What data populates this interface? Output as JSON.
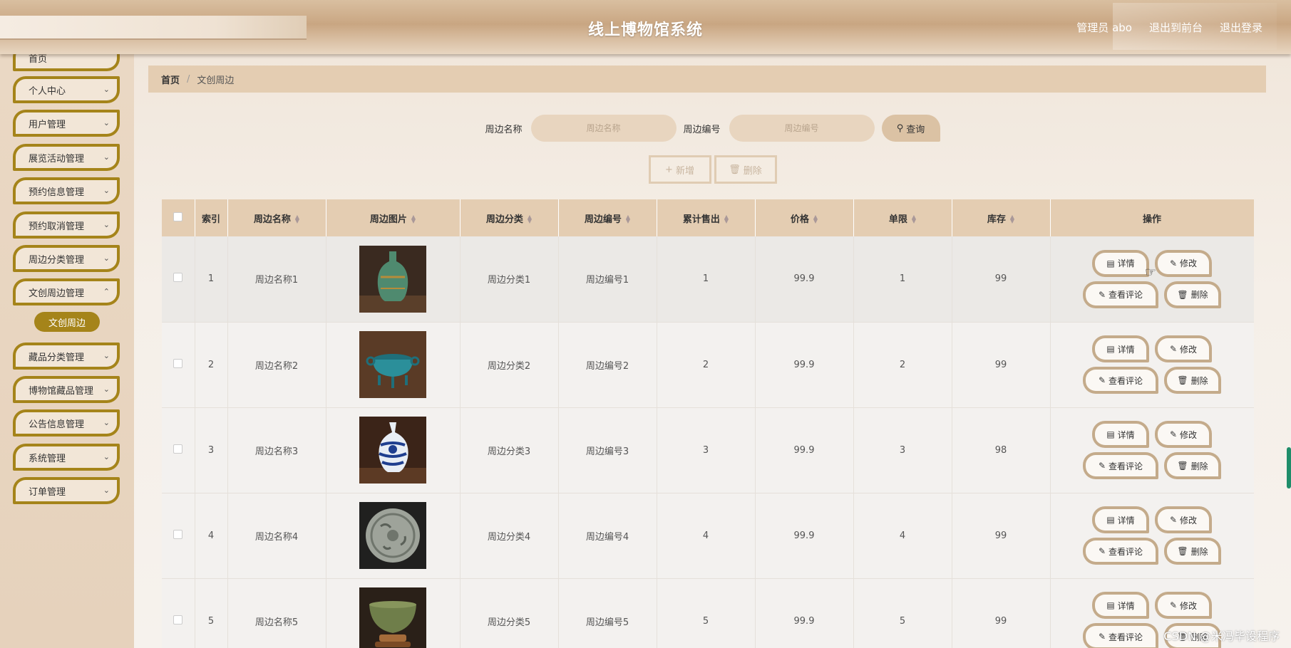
{
  "header": {
    "title": "线上博物馆系统",
    "links": [
      "管理员 abo",
      "退出到前台",
      "退出登录"
    ]
  },
  "sidebar": {
    "items": [
      {
        "label": "首页",
        "has_children": false
      },
      {
        "label": "个人中心",
        "has_children": true
      },
      {
        "label": "用户管理",
        "has_children": true
      },
      {
        "label": "展览活动管理",
        "has_children": true
      },
      {
        "label": "预约信息管理",
        "has_children": true
      },
      {
        "label": "预约取消管理",
        "has_children": true
      },
      {
        "label": "周边分类管理",
        "has_children": true
      },
      {
        "label": "文创周边管理",
        "has_children": true,
        "expanded": true
      },
      {
        "label": "藏品分类管理",
        "has_children": true
      },
      {
        "label": "博物馆藏品管理",
        "has_children": true
      },
      {
        "label": "公告信息管理",
        "has_children": true
      },
      {
        "label": "系统管理",
        "has_children": true
      },
      {
        "label": "订单管理",
        "has_children": true
      }
    ],
    "active_sub": "文创周边"
  },
  "breadcrumb": {
    "home": "首页",
    "separator": "/",
    "current": "文创周边"
  },
  "search": {
    "name_label": "周边名称",
    "name_placeholder": "周边名称",
    "code_label": "周边编号",
    "code_placeholder": "周边编号",
    "query_label": "查询"
  },
  "actions": {
    "add": "新增",
    "delete": "删除"
  },
  "table": {
    "columns": [
      "索引",
      "周边名称",
      "周边图片",
      "周边分类",
      "周边编号",
      "累计售出",
      "价格",
      "单限",
      "库存",
      "操作"
    ],
    "rows": [
      {
        "index": "1",
        "name": "周边名称1",
        "image": "green-vase",
        "category": "周边分类1",
        "code": "周边编号1",
        "sold": "1",
        "price": "99.9",
        "limit": "1",
        "stock": "99"
      },
      {
        "index": "2",
        "name": "周边名称2",
        "image": "blue-censer",
        "category": "周边分类2",
        "code": "周边编号2",
        "sold": "2",
        "price": "99.9",
        "limit": "2",
        "stock": "99"
      },
      {
        "index": "3",
        "name": "周边名称3",
        "image": "blue-white-vase",
        "category": "周边分类3",
        "code": "周边编号3",
        "sold": "3",
        "price": "99.9",
        "limit": "3",
        "stock": "98"
      },
      {
        "index": "4",
        "name": "周边名称4",
        "image": "round-mirror",
        "category": "周边分类4",
        "code": "周边编号4",
        "sold": "4",
        "price": "99.9",
        "limit": "4",
        "stock": "99"
      },
      {
        "index": "5",
        "name": "周边名称5",
        "image": "celadon-bowl",
        "category": "周边分类5",
        "code": "周边编号5",
        "sold": "5",
        "price": "99.9",
        "limit": "5",
        "stock": "99"
      }
    ],
    "row_actions": {
      "detail": "详情",
      "edit": "修改",
      "comments": "查看评论",
      "delete": "删除"
    }
  },
  "watermark": "CSDN @米冯毕设程序",
  "colors": {
    "accent": "#a5841a",
    "header": "#c9a682",
    "table_header": "#e4cdb2"
  }
}
